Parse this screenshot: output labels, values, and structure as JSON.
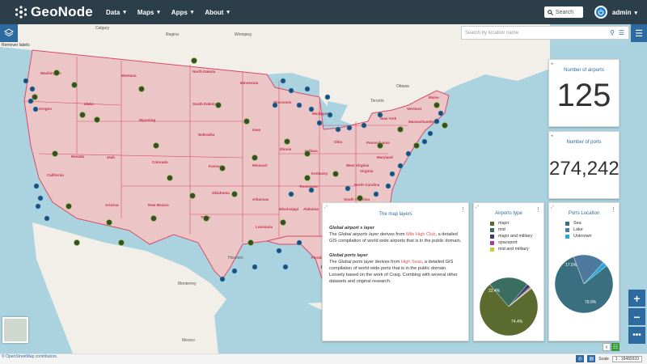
{
  "app": {
    "brand": "GeoNode"
  },
  "nav": [
    {
      "label": "Data"
    },
    {
      "label": "Maps"
    },
    {
      "label": "Apps"
    },
    {
      "label": "About"
    }
  ],
  "header": {
    "search_placeholder": "Search",
    "user": "admin"
  },
  "map": {
    "layer_switcher_label": "Remover labels",
    "location_placeholder": "Search by location name",
    "states": [
      "Washington",
      "Oregon",
      "California",
      "Nevada",
      "Idaho",
      "Montana",
      "Wyoming",
      "Utah",
      "Arizona",
      "Colorado",
      "New Mexico",
      "North Dakota",
      "South Dakota",
      "Nebraska",
      "Kansas",
      "Oklahoma",
      "Texas",
      "Minnesota",
      "Iowa",
      "Missouri",
      "Arkansas",
      "Louisiana",
      "Wisconsin",
      "Illinois",
      "Michigan",
      "Indiana",
      "Ohio",
      "Kentucky",
      "Tennessee",
      "Mississippi",
      "Alabama",
      "Georgia",
      "Florida",
      "South Carolina",
      "North Carolina",
      "Virginia",
      "West Virginia",
      "Pennsylvania",
      "New York",
      "Vermont",
      "Maine",
      "Massachusetts",
      "Maryland"
    ],
    "cities": [
      "Calgary",
      "Regina",
      "Winnipeg",
      "Ottawa",
      "Toronto",
      "Houston",
      "Monterrey",
      "Mexico"
    ],
    "attribution": "© OpenStreetMap contributors.",
    "scale_label": "Scale",
    "scale_value": "1 : 18489333",
    "colors": {
      "water": "#aad3df",
      "land": "#f2efe9",
      "usa": "#ecc6c6",
      "border": "#d94b6a"
    }
  },
  "widgets": {
    "airports": {
      "title": "Number of airports",
      "value": "125"
    },
    "ports": {
      "title": "Number of ports",
      "value": "274,242"
    },
    "text": {
      "title": "The map layers",
      "sub1": "Global airport s layer",
      "p1_a": "The ",
      "p1_em": "Global airports layer",
      "p1_b": " derives from ",
      "p1_link": "Mile High Club",
      "p1_c": ", a detailed GIS compilation of world wide airports that is in the public domain.",
      "sub2": "Global ports layer",
      "p2_a": "The ",
      "p2_em": "Global ports layer",
      "p2_b": " derives from ",
      "p2_link": "High Seas",
      "p2_c": ", a detailed GIS compilation of world wide ports that is in the public domain. Loosely based on the work of Craig. Combing with several other datasets and original research."
    },
    "airports_type": {
      "title": "Airports type",
      "legend": [
        {
          "label": "major",
          "color": "#5b6a2e"
        },
        {
          "label": "mid",
          "color": "#3a6e60"
        },
        {
          "label": "major and military",
          "color": "#3d3d70"
        },
        {
          "label": "spaceport",
          "color": "#a23aa0"
        },
        {
          "label": "mid and military",
          "color": "#c9c93a"
        }
      ],
      "slice_labels": [
        "22.4%",
        "74.4%"
      ]
    },
    "ports_location": {
      "title": "Ports Location",
      "legend": [
        {
          "label": "Sea",
          "color": "#3a6f80"
        },
        {
          "label": "Lake",
          "color": "#4f7aa0"
        },
        {
          "label": "Unknown",
          "color": "#2ca8d6"
        }
      ],
      "slice_labels": [
        "17.5%",
        "79.9%"
      ]
    }
  },
  "chart_data": [
    {
      "type": "pie",
      "title": "Airports type",
      "categories": [
        "major",
        "mid",
        "major and military",
        "spaceport",
        "mid and military"
      ],
      "values": [
        74.4,
        22.4,
        2.0,
        0.6,
        0.6
      ]
    },
    {
      "type": "pie",
      "title": "Ports Location",
      "categories": [
        "Sea",
        "Lake",
        "Unknown"
      ],
      "values": [
        79.9,
        17.5,
        2.6
      ]
    }
  ]
}
